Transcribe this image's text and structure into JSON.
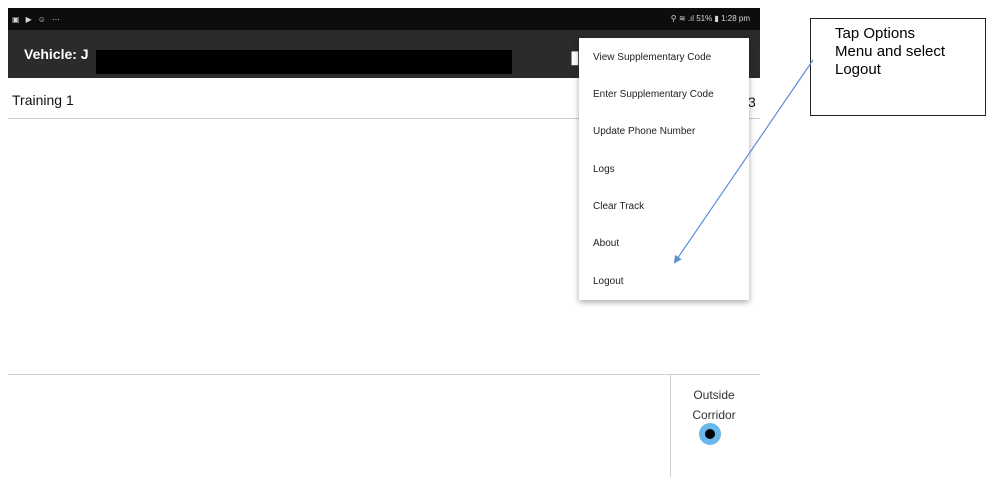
{
  "status_bar": {
    "left_icons": [
      "screenshot-icon",
      "play-icon",
      "android-icon",
      "ellipsis-icon"
    ],
    "right_text": "⚲ ≋ .ıl 51% ▮ 1:28 pm"
  },
  "app_bar": {
    "vehicle_label": "Vehicle: J",
    "overflow_icon": "overflow-menu-icon"
  },
  "subtitle": {
    "text": "Training 1",
    "right_partial": "3"
  },
  "menu": {
    "items": [
      "View Supplementary Code",
      "Enter Supplementary Code",
      "Update Phone Number",
      "Logs",
      "Clear Track",
      "About",
      "Logout"
    ]
  },
  "corridor": {
    "label": "Outside\nCorridor",
    "dot_color": "#6ab7ec"
  },
  "annotation": {
    "text": "Tap Options\nMenu and select\nLogout",
    "arrow_color": "#5b8ed6"
  }
}
